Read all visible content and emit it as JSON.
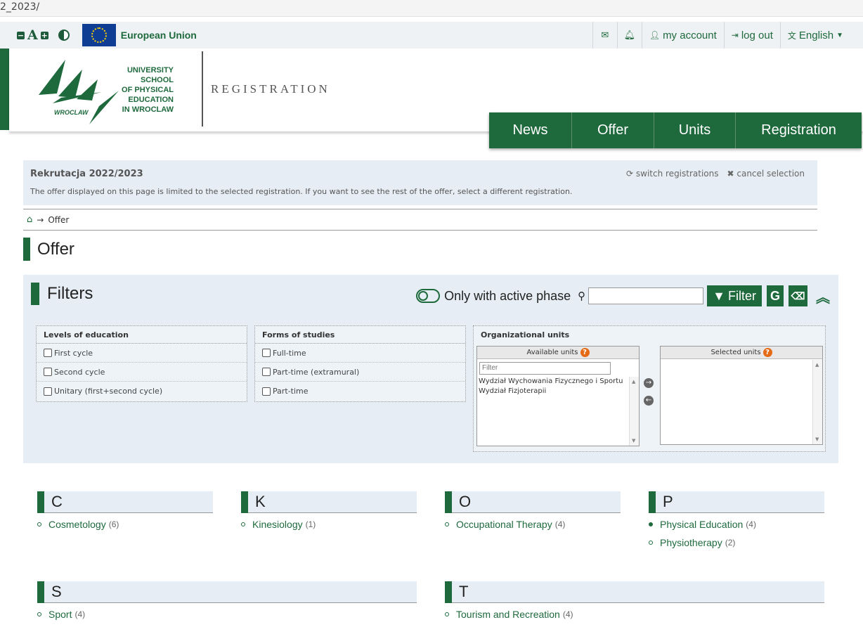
{
  "browser": {
    "url_fragment": "2_2023/"
  },
  "topbar": {
    "font_decrease": "−",
    "font_letter": "A",
    "font_increase": "+",
    "eu_label": "European Union",
    "mail_icon": "envelope-icon",
    "bell_icon": "bell-icon",
    "account_label": "my account",
    "logout_label": "log out",
    "language_label": "English"
  },
  "header": {
    "logo_text": "WROCLAW",
    "university_lines": [
      "UNIVERSITY",
      "SCHOOL",
      "OF PHYSICAL",
      "EDUCATION",
      "IN WROCLAW"
    ],
    "section_title": "REGISTRATION"
  },
  "nav": {
    "items": [
      {
        "label": "News"
      },
      {
        "label": "Offer"
      },
      {
        "label": "Units"
      },
      {
        "label": "Registration"
      }
    ]
  },
  "registration_banner": {
    "title": "Rekrutacja 2022/2023",
    "description": "The offer displayed on this page is limited to the selected registration. If you want to see the rest of the offer, select a different registration.",
    "switch_label": "switch registrations",
    "cancel_label": "cancel selection"
  },
  "breadcrumb": {
    "arrow": "→",
    "current": "Offer"
  },
  "page_title": "Offer",
  "filters": {
    "title": "Filters",
    "active_phase_label": "Only with active phase",
    "search_value": "",
    "filter_button": "Filter",
    "g_button": "G",
    "levels": {
      "title": "Levels of education",
      "options": [
        "First cycle",
        "Second cycle",
        "Unitary (first+second cycle)"
      ]
    },
    "forms": {
      "title": "Forms of studies",
      "options": [
        "Full-time",
        "Part-time (extramural)",
        "Part-time"
      ]
    },
    "units": {
      "title": "Organizational units",
      "available_title": "Available units",
      "selected_title": "Selected units",
      "filter_placeholder": "Filter",
      "available": [
        "Wydział Wychowania Fizycznego i Sportu",
        "Wydział Fizjoterapii"
      ],
      "selected": []
    }
  },
  "offer_index": [
    {
      "letter": "C",
      "items": [
        {
          "label": "Cosmetology",
          "count": "(6)"
        }
      ]
    },
    {
      "letter": "K",
      "items": [
        {
          "label": "Kinesiology",
          "count": "(1)"
        }
      ]
    },
    {
      "letter": "O",
      "items": [
        {
          "label": "Occupational Therapy",
          "count": "(4)"
        }
      ]
    },
    {
      "letter": "P",
      "items": [
        {
          "label": "Physical Education",
          "count": "(4)"
        },
        {
          "label": "Physiotherapy",
          "count": "(2)"
        }
      ]
    },
    {
      "letter": "S",
      "items": [
        {
          "label": "Sport",
          "count": "(4)"
        }
      ]
    },
    {
      "letter": "T",
      "items": [
        {
          "label": "Tourism and Recreation",
          "count": "(4)"
        }
      ]
    }
  ],
  "colors": {
    "brand_green": "#1e6a3d",
    "panel_blue": "#e6edf4",
    "help_orange": "#e56a15"
  }
}
